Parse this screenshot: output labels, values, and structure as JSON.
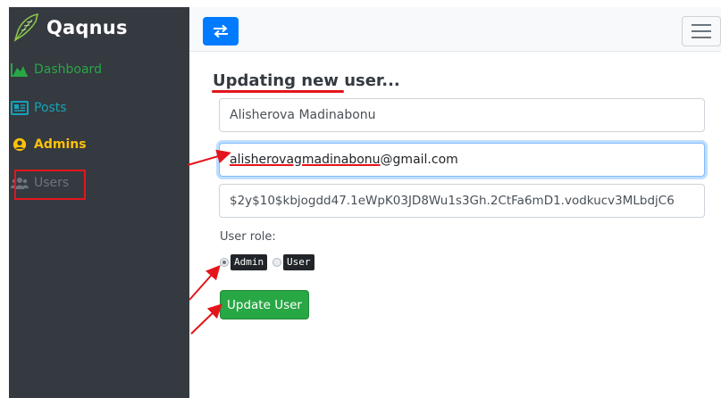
{
  "brand": {
    "name": "Qaqnus",
    "icon": "feather-icon"
  },
  "sidebar": {
    "items": [
      {
        "label": "Dashboard",
        "icon": "chart-area-icon",
        "color": "#28a745"
      },
      {
        "label": "Posts",
        "icon": "newspaper-icon",
        "color": "#17a2b8"
      },
      {
        "label": "Admins",
        "icon": "user-circle-icon",
        "color": "#ffc107"
      },
      {
        "label": "Users",
        "icon": "users-icon",
        "color": "#6c757d"
      }
    ]
  },
  "topbar": {
    "toggle_icon": "exchange-icon",
    "menu_icon": "hamburger-icon"
  },
  "form": {
    "title": "Updating new user...",
    "name_value": "Alisherova Madinabonu",
    "email_user": "alisherovagmadinabonu",
    "email_domain": "@gmail.com",
    "password_value": "$2y$10$kbjogdd47.1eWpK03JD8Wu1s3Gh.2CtFa6mD1.vodkucv3MLbdjC6",
    "role_label": "User role:",
    "roles": [
      {
        "label": "Admin",
        "checked": true
      },
      {
        "label": "User",
        "checked": false
      }
    ],
    "submit_label": "Update User"
  },
  "colors": {
    "sidebar_bg": "#343a40",
    "accent": "#007bff",
    "annotation": "#e4151c",
    "submit": "#28a745"
  }
}
